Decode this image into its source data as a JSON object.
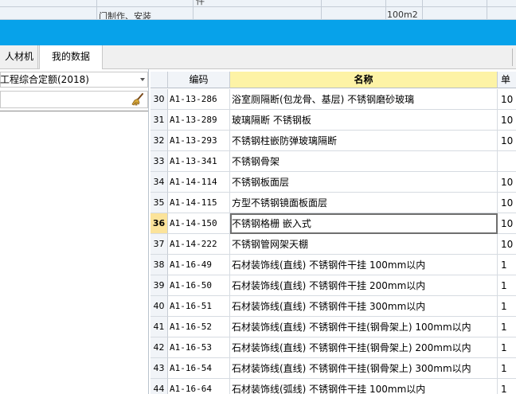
{
  "background_window": {
    "row_text_1": "件",
    "row_text_2": "门制作、安装",
    "row_text_3": "100m2"
  },
  "tabs": [
    {
      "label": "人材机"
    },
    {
      "label": "我的数据"
    }
  ],
  "left_panel": {
    "quota_select_value": "工程综合定额(2018)",
    "search_value": ""
  },
  "grid": {
    "headers": {
      "code": "编码",
      "name": "名称",
      "unit": "单"
    },
    "selected_row": 36,
    "rows": [
      {
        "num": "30",
        "code": "A1-13-286",
        "name": "浴室厕隔断(包龙骨、基层) 不锈钢磨砂玻璃",
        "unit": "10"
      },
      {
        "num": "31",
        "code": "A1-13-289",
        "name": "玻璃隔断 不锈钢板",
        "unit": "10"
      },
      {
        "num": "32",
        "code": "A1-13-293",
        "name": "不锈钢柱嵌防弹玻璃隔断",
        "unit": "10"
      },
      {
        "num": "33",
        "code": "A1-13-341",
        "name": "不锈钢骨架",
        "unit": ""
      },
      {
        "num": "34",
        "code": "A1-14-114",
        "name": "不锈钢板面层",
        "unit": "10"
      },
      {
        "num": "35",
        "code": "A1-14-115",
        "name": "方型不锈钢镜面板面层",
        "unit": "10"
      },
      {
        "num": "36",
        "code": "A1-14-150",
        "name": "不锈钢格栅 嵌入式",
        "unit": "10"
      },
      {
        "num": "37",
        "code": "A1-14-222",
        "name": "不锈钢管网架天棚",
        "unit": "10"
      },
      {
        "num": "38",
        "code": "A1-16-49",
        "name": "石材装饰线(直线) 不锈钢件干挂 100mm以内",
        "unit": "1"
      },
      {
        "num": "39",
        "code": "A1-16-50",
        "name": "石材装饰线(直线) 不锈钢件干挂 200mm以内",
        "unit": "1"
      },
      {
        "num": "40",
        "code": "A1-16-51",
        "name": "石材装饰线(直线) 不锈钢件干挂 300mm以内",
        "unit": "1"
      },
      {
        "num": "41",
        "code": "A1-16-52",
        "name": "石材装饰线(直线) 不锈钢件干挂(钢骨架上) 100mm以内",
        "unit": "1"
      },
      {
        "num": "42",
        "code": "A1-16-53",
        "name": "石材装饰线(直线) 不锈钢件干挂(钢骨架上) 200mm以内",
        "unit": "1"
      },
      {
        "num": "43",
        "code": "A1-16-54",
        "name": "石材装饰线(直线) 不锈钢件干挂(钢骨架上) 300mm以内",
        "unit": "1"
      },
      {
        "num": "44",
        "code": "A1-16-64",
        "name": "石材装饰线(弧线) 不锈钢件干挂 100mm以内",
        "unit": "1"
      }
    ]
  },
  "colors": {
    "titlebar": "#07a2ea",
    "header_highlight": "#fdf3a6",
    "selected_row_number": "#fbe39a"
  },
  "icons": {
    "clear_search": "broom-icon",
    "dropdown": "chevron-down-icon"
  }
}
